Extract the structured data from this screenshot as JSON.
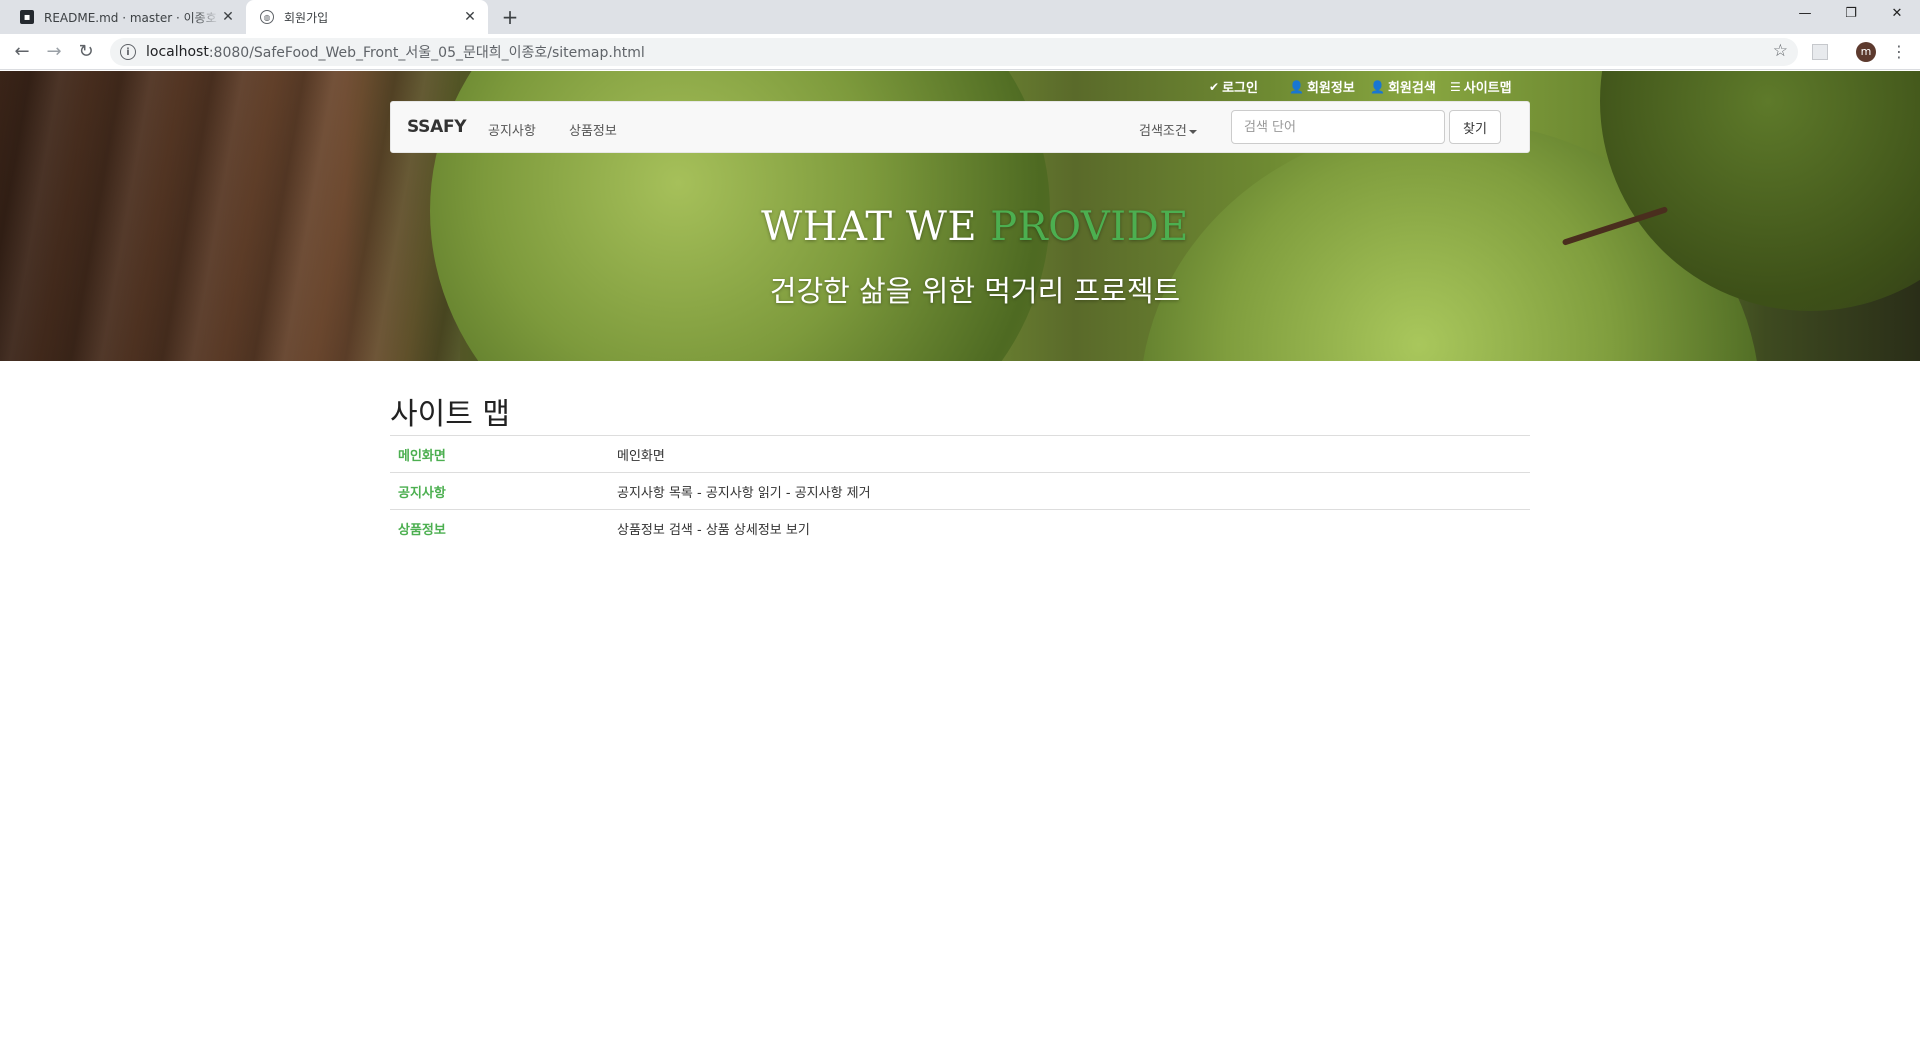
{
  "browser": {
    "tabs": [
      {
        "title": "README.md · master · 이종호 / ",
        "favicon": "github-icon",
        "active": false
      },
      {
        "title": "회원가입",
        "favicon": "globe-icon",
        "active": true
      }
    ],
    "new_tab": "+",
    "close": "✕",
    "url_host": "localhost",
    "url_path": ":8080/SafeFood_Web_Front_서울_05_문대희_이종호/sitemap.html",
    "profile_initial": "m",
    "window_controls": {
      "minimize": "—",
      "maximize": "❐",
      "close": "✕"
    }
  },
  "topmenu": {
    "login": "로그인",
    "member_info": "회원정보",
    "member_search": "회원검색",
    "sitemap": "사이트맵"
  },
  "navbar": {
    "brand": "SSAFY",
    "links": [
      "공지사항",
      "상품정보"
    ],
    "search_condition": "검색조건",
    "search_placeholder": "검색 단어",
    "search_button": "찾기"
  },
  "hero": {
    "title_plain": "WHAT WE ",
    "title_accent": "PROVIDE",
    "subtitle": "건강한 삶을 위한 먹거리 프로젝트",
    "accent_color": "#4caf50"
  },
  "sitemap": {
    "title": "사이트 맵",
    "rows": [
      {
        "section": "메인화면",
        "description": "메인화면"
      },
      {
        "section": "공지사항",
        "description": "공지사항 목록 - 공지사항 읽기 - 공지사항 제거"
      },
      {
        "section": "상품정보",
        "description": "상품정보 검색 - 상품 상세정보 보기"
      }
    ]
  }
}
